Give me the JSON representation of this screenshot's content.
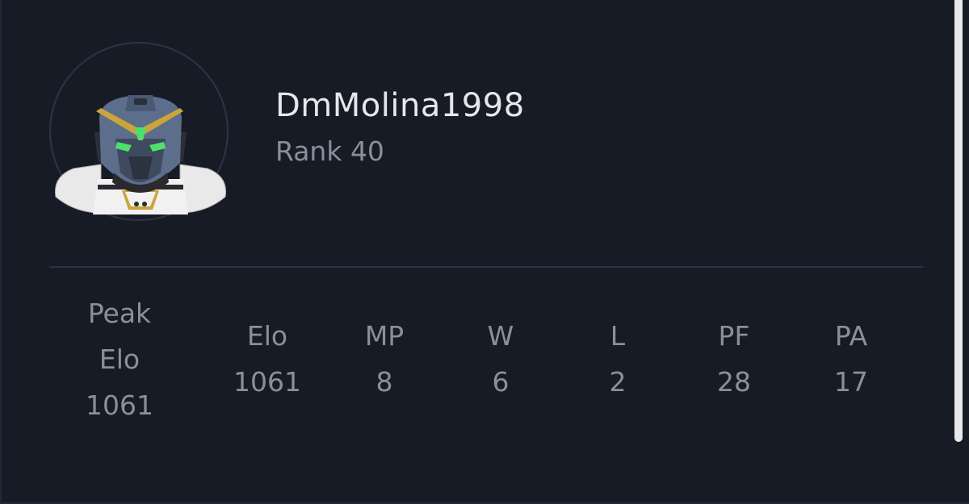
{
  "profile": {
    "username": "DmMolina1998",
    "rank": "Rank 40"
  },
  "stats": {
    "peak_elo": {
      "label_line1": "Peak",
      "label_line2": "Elo",
      "value": "1061"
    },
    "elo": {
      "label": "Elo",
      "value": "1061"
    },
    "mp": {
      "label": "MP",
      "value": "8"
    },
    "w": {
      "label": "W",
      "value": "6"
    },
    "l": {
      "label": "L",
      "value": "2"
    },
    "pf": {
      "label": "PF",
      "value": "28"
    },
    "pa": {
      "label": "PA",
      "value": "17"
    }
  },
  "colors": {
    "background": "#171b26",
    "text_primary": "#e6e7ea",
    "text_secondary": "#8a8f9a",
    "divider": "#2b3242",
    "avatar_accent": "#c9a53a",
    "avatar_eyes": "#4ee06a"
  },
  "icons": {
    "avatar": "robot-mech-helmet-avatar"
  }
}
